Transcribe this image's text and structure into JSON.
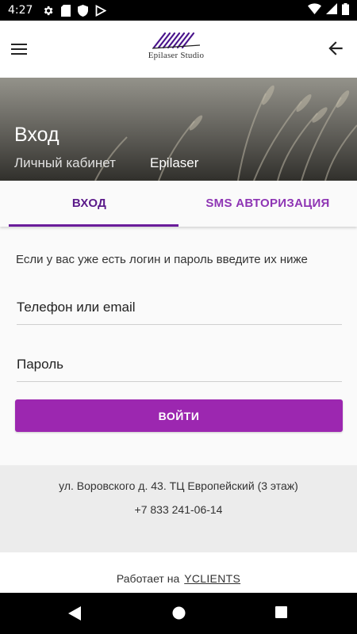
{
  "status_bar": {
    "time": "4:27"
  },
  "app_bar": {
    "brand": "Epilaser Studio"
  },
  "hero": {
    "title": "Вход",
    "subtitle": "Личный кабинет",
    "company": "Epilaser"
  },
  "tabs": [
    {
      "label": "ВХОД"
    },
    {
      "label": "SMS АВТОРИЗАЦИЯ"
    }
  ],
  "form": {
    "intro": "Если у вас уже есть логин и пароль введите их ниже",
    "login_placeholder": "Телефон или email",
    "password_placeholder": "Пароль",
    "submit_label": "ВОЙТИ"
  },
  "footer": {
    "address": "ул. Воровского д. 43. ТЦ Европейский (3 этаж)",
    "phone": "+7 833 241-06-14",
    "powered_prefix": "Работает на",
    "powered_link": "YCLIENTS"
  },
  "colors": {
    "accent": "#9c27b0",
    "tab_indicator": "#6a1b9a",
    "tab_active_text": "#5b1a8a"
  }
}
